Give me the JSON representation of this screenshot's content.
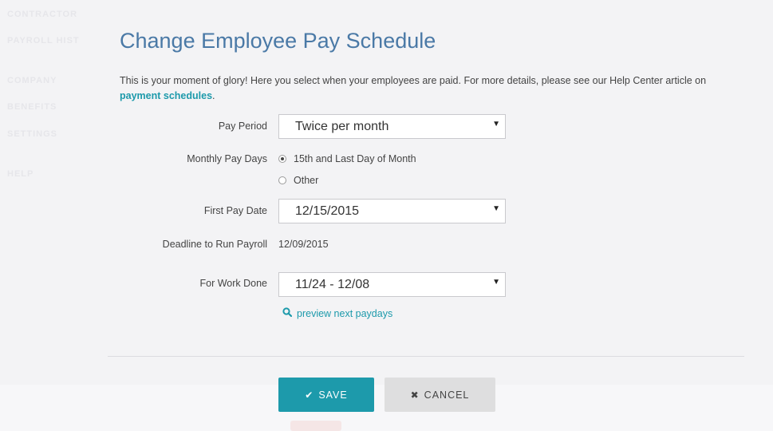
{
  "background": {
    "nav_items": [
      "CONTRACTOR",
      "PAYROLL HIST",
      "COMPANY",
      "BENEFITS",
      "SETTINGS",
      "HELP"
    ]
  },
  "modal": {
    "title": "Change Employee Pay Schedule",
    "intro_text": "This is your moment of glory! Here you select when your employees are paid. For more details, please see our Help Center article on ",
    "intro_link": "payment schedules",
    "intro_end": "."
  },
  "form": {
    "pay_period": {
      "label": "Pay Period",
      "value": "Twice per month"
    },
    "monthly_pay_days": {
      "label": "Monthly Pay Days",
      "options": [
        {
          "label": "15th and Last Day of Month",
          "selected": true
        },
        {
          "label": "Other",
          "selected": false
        }
      ]
    },
    "first_pay_date": {
      "label": "First Pay Date",
      "value": "12/15/2015"
    },
    "deadline": {
      "label": "Deadline to Run Payroll",
      "value": "12/09/2015"
    },
    "work_done": {
      "label": "For Work Done",
      "value": "11/24 - 12/08"
    },
    "preview_link": "preview next paydays"
  },
  "buttons": {
    "save": "SAVE",
    "cancel": "CANCEL"
  },
  "icons": {
    "caret": "caret-down-icon",
    "search": "search-icon",
    "check": "check-icon",
    "close": "close-icon"
  },
  "colors": {
    "accent": "#1d9aab",
    "title": "#4a79a6",
    "background": "#f3f3f5"
  }
}
